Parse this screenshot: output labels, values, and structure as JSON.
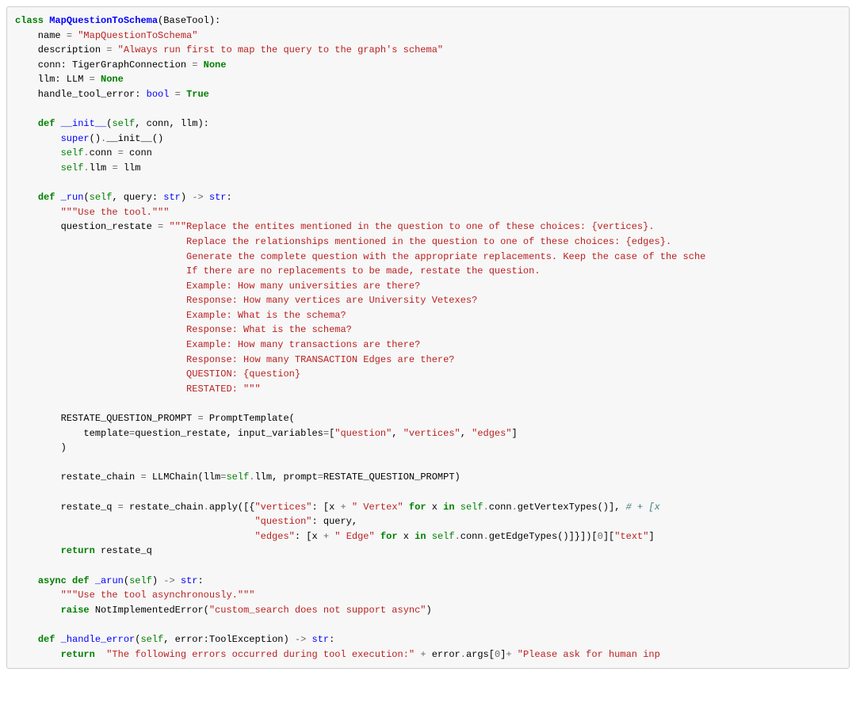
{
  "code": {
    "tokens": [
      {
        "cls": "kw",
        "t": "class"
      },
      {
        "t": " "
      },
      {
        "cls": "cls",
        "t": "MapQuestionToSchema"
      },
      {
        "t": "(BaseTool):"
      },
      {
        "br": 1
      },
      {
        "t": "    name "
      },
      {
        "cls": "op",
        "t": "="
      },
      {
        "t": " "
      },
      {
        "cls": "str",
        "t": "\"MapQuestionToSchema\""
      },
      {
        "br": 1
      },
      {
        "t": "    description "
      },
      {
        "cls": "op",
        "t": "="
      },
      {
        "t": " "
      },
      {
        "cls": "str",
        "t": "\"Always run first to map the query to the graph's schema\""
      },
      {
        "br": 1
      },
      {
        "t": "    conn: TigerGraphConnection "
      },
      {
        "cls": "op",
        "t": "="
      },
      {
        "t": " "
      },
      {
        "cls": "bool",
        "t": "None"
      },
      {
        "br": 1
      },
      {
        "t": "    llm: LLM "
      },
      {
        "cls": "op",
        "t": "="
      },
      {
        "t": " "
      },
      {
        "cls": "bool",
        "t": "None"
      },
      {
        "br": 1
      },
      {
        "t": "    handle_tool_error: "
      },
      {
        "cls": "nm",
        "t": "bool"
      },
      {
        "t": " "
      },
      {
        "cls": "op",
        "t": "="
      },
      {
        "t": " "
      },
      {
        "cls": "bool",
        "t": "True"
      },
      {
        "br": 1
      },
      {
        "br": 1
      },
      {
        "t": "    "
      },
      {
        "cls": "kw",
        "t": "def"
      },
      {
        "t": " "
      },
      {
        "cls": "fn",
        "t": "__init__"
      },
      {
        "t": "("
      },
      {
        "cls": "slf",
        "t": "self"
      },
      {
        "t": ", conn, llm):"
      },
      {
        "br": 1
      },
      {
        "t": "        "
      },
      {
        "cls": "nm",
        "t": "super"
      },
      {
        "t": "()"
      },
      {
        "cls": "op",
        "t": "."
      },
      {
        "t": "__init__()"
      },
      {
        "br": 1
      },
      {
        "t": "        "
      },
      {
        "cls": "slf",
        "t": "self"
      },
      {
        "cls": "op",
        "t": "."
      },
      {
        "t": "conn "
      },
      {
        "cls": "op",
        "t": "="
      },
      {
        "t": " conn"
      },
      {
        "br": 1
      },
      {
        "t": "        "
      },
      {
        "cls": "slf",
        "t": "self"
      },
      {
        "cls": "op",
        "t": "."
      },
      {
        "t": "llm "
      },
      {
        "cls": "op",
        "t": "="
      },
      {
        "t": " llm"
      },
      {
        "br": 1
      },
      {
        "br": 1
      },
      {
        "t": "    "
      },
      {
        "cls": "kw",
        "t": "def"
      },
      {
        "t": " "
      },
      {
        "cls": "fn",
        "t": "_run"
      },
      {
        "t": "("
      },
      {
        "cls": "slf",
        "t": "self"
      },
      {
        "t": ", query: "
      },
      {
        "cls": "nm",
        "t": "str"
      },
      {
        "t": ") "
      },
      {
        "cls": "op",
        "t": "->"
      },
      {
        "t": " "
      },
      {
        "cls": "nm",
        "t": "str"
      },
      {
        "t": ":"
      },
      {
        "br": 1
      },
      {
        "t": "        "
      },
      {
        "cls": "str",
        "t": "\"\"\"Use the tool.\"\"\""
      },
      {
        "br": 1
      },
      {
        "t": "        question_restate "
      },
      {
        "cls": "op",
        "t": "="
      },
      {
        "t": " "
      },
      {
        "cls": "str",
        "t": "\"\"\"Replace the entites mentioned in the question to one of these choices: {vertices}."
      },
      {
        "br": 1
      },
      {
        "t": "                              "
      },
      {
        "cls": "str",
        "t": "Replace the relationships mentioned in the question to one of these choices: {edges}."
      },
      {
        "br": 1
      },
      {
        "t": "                              "
      },
      {
        "cls": "str",
        "t": "Generate the complete question with the appropriate replacements. Keep the case of the sche"
      },
      {
        "br": 1
      },
      {
        "t": "                              "
      },
      {
        "cls": "str",
        "t": "If there are no replacements to be made, restate the question."
      },
      {
        "br": 1
      },
      {
        "t": "                              "
      },
      {
        "cls": "str",
        "t": "Example: How many universities are there?"
      },
      {
        "br": 1
      },
      {
        "t": "                              "
      },
      {
        "cls": "str",
        "t": "Response: How many vertices are University Vetexes?"
      },
      {
        "br": 1
      },
      {
        "t": "                              "
      },
      {
        "cls": "str",
        "t": "Example: What is the schema?"
      },
      {
        "br": 1
      },
      {
        "t": "                              "
      },
      {
        "cls": "str",
        "t": "Response: What is the schema?"
      },
      {
        "br": 1
      },
      {
        "t": "                              "
      },
      {
        "cls": "str",
        "t": "Example: How many transactions are there?"
      },
      {
        "br": 1
      },
      {
        "t": "                              "
      },
      {
        "cls": "str",
        "t": "Response: How many TRANSACTION Edges are there?"
      },
      {
        "br": 1
      },
      {
        "t": "                              "
      },
      {
        "cls": "str",
        "t": "QUESTION: {question}"
      },
      {
        "br": 1
      },
      {
        "t": "                              "
      },
      {
        "cls": "str",
        "t": "RESTATED: \"\"\""
      },
      {
        "br": 1
      },
      {
        "br": 1
      },
      {
        "t": "        RESTATE_QUESTION_PROMPT "
      },
      {
        "cls": "op",
        "t": "="
      },
      {
        "t": " PromptTemplate("
      },
      {
        "br": 1
      },
      {
        "t": "            template"
      },
      {
        "cls": "op",
        "t": "="
      },
      {
        "t": "question_restate, input_variables"
      },
      {
        "cls": "op",
        "t": "="
      },
      {
        "t": "["
      },
      {
        "cls": "str",
        "t": "\"question\""
      },
      {
        "t": ", "
      },
      {
        "cls": "str",
        "t": "\"vertices\""
      },
      {
        "t": ", "
      },
      {
        "cls": "str",
        "t": "\"edges\""
      },
      {
        "t": "]"
      },
      {
        "br": 1
      },
      {
        "t": "        )"
      },
      {
        "br": 1
      },
      {
        "br": 1
      },
      {
        "t": "        restate_chain "
      },
      {
        "cls": "op",
        "t": "="
      },
      {
        "t": " LLMChain(llm"
      },
      {
        "cls": "op",
        "t": "="
      },
      {
        "cls": "slf",
        "t": "self"
      },
      {
        "cls": "op",
        "t": "."
      },
      {
        "t": "llm, prompt"
      },
      {
        "cls": "op",
        "t": "="
      },
      {
        "t": "RESTATE_QUESTION_PROMPT)"
      },
      {
        "br": 1
      },
      {
        "br": 1
      },
      {
        "t": "        restate_q "
      },
      {
        "cls": "op",
        "t": "="
      },
      {
        "t": " restate_chain"
      },
      {
        "cls": "op",
        "t": "."
      },
      {
        "t": "apply([{"
      },
      {
        "cls": "str",
        "t": "\"vertices\""
      },
      {
        "t": ": [x "
      },
      {
        "cls": "op",
        "t": "+"
      },
      {
        "t": " "
      },
      {
        "cls": "str",
        "t": "\" Vertex\""
      },
      {
        "t": " "
      },
      {
        "cls": "kw",
        "t": "for"
      },
      {
        "t": " x "
      },
      {
        "cls": "kw",
        "t": "in"
      },
      {
        "t": " "
      },
      {
        "cls": "slf",
        "t": "self"
      },
      {
        "cls": "op",
        "t": "."
      },
      {
        "t": "conn"
      },
      {
        "cls": "op",
        "t": "."
      },
      {
        "t": "getVertexTypes()], "
      },
      {
        "cls": "cmt",
        "t": "# + [x"
      },
      {
        "br": 1
      },
      {
        "t": "                                          "
      },
      {
        "cls": "str",
        "t": "\"question\""
      },
      {
        "t": ": query,"
      },
      {
        "br": 1
      },
      {
        "t": "                                          "
      },
      {
        "cls": "str",
        "t": "\"edges\""
      },
      {
        "t": ": [x "
      },
      {
        "cls": "op",
        "t": "+"
      },
      {
        "t": " "
      },
      {
        "cls": "str",
        "t": "\" Edge\""
      },
      {
        "t": " "
      },
      {
        "cls": "kw",
        "t": "for"
      },
      {
        "t": " x "
      },
      {
        "cls": "kw",
        "t": "in"
      },
      {
        "t": " "
      },
      {
        "cls": "slf",
        "t": "self"
      },
      {
        "cls": "op",
        "t": "."
      },
      {
        "t": "conn"
      },
      {
        "cls": "op",
        "t": "."
      },
      {
        "t": "getEdgeTypes()]}])["
      },
      {
        "cls": "num",
        "t": "0"
      },
      {
        "t": "]["
      },
      {
        "cls": "str",
        "t": "\"text\""
      },
      {
        "t": "]"
      },
      {
        "br": 1
      },
      {
        "t": "        "
      },
      {
        "cls": "kw",
        "t": "return"
      },
      {
        "t": " restate_q"
      },
      {
        "br": 1
      },
      {
        "br": 1
      },
      {
        "t": "    "
      },
      {
        "cls": "kw",
        "t": "async"
      },
      {
        "t": " "
      },
      {
        "cls": "kw",
        "t": "def"
      },
      {
        "t": " "
      },
      {
        "cls": "fn",
        "t": "_arun"
      },
      {
        "t": "("
      },
      {
        "cls": "slf",
        "t": "self"
      },
      {
        "t": ") "
      },
      {
        "cls": "op",
        "t": "->"
      },
      {
        "t": " "
      },
      {
        "cls": "nm",
        "t": "str"
      },
      {
        "t": ":"
      },
      {
        "br": 1
      },
      {
        "t": "        "
      },
      {
        "cls": "str",
        "t": "\"\"\"Use the tool asynchronously.\"\"\""
      },
      {
        "br": 1
      },
      {
        "t": "        "
      },
      {
        "cls": "kw",
        "t": "raise"
      },
      {
        "t": " "
      },
      {
        "cls": "",
        "t": "NotImplementedError"
      },
      {
        "t": "("
      },
      {
        "cls": "str",
        "t": "\"custom_search does not support async\""
      },
      {
        "t": ")"
      },
      {
        "br": 1
      },
      {
        "br": 1
      },
      {
        "t": "    "
      },
      {
        "cls": "kw",
        "t": "def"
      },
      {
        "t": " "
      },
      {
        "cls": "fn",
        "t": "_handle_error"
      },
      {
        "t": "("
      },
      {
        "cls": "slf",
        "t": "self"
      },
      {
        "t": ", error:ToolException) "
      },
      {
        "cls": "op",
        "t": "->"
      },
      {
        "t": " "
      },
      {
        "cls": "nm",
        "t": "str"
      },
      {
        "t": ":"
      },
      {
        "br": 1
      },
      {
        "t": "        "
      },
      {
        "cls": "kw",
        "t": "return"
      },
      {
        "t": "  "
      },
      {
        "cls": "str",
        "t": "\"The following errors occurred during tool execution:\""
      },
      {
        "t": " "
      },
      {
        "cls": "op",
        "t": "+"
      },
      {
        "t": " error"
      },
      {
        "cls": "op",
        "t": "."
      },
      {
        "t": "args["
      },
      {
        "cls": "num",
        "t": "0"
      },
      {
        "t": "]"
      },
      {
        "cls": "op",
        "t": "+"
      },
      {
        "t": " "
      },
      {
        "cls": "str",
        "t": "\"Please ask for human inp"
      }
    ]
  }
}
